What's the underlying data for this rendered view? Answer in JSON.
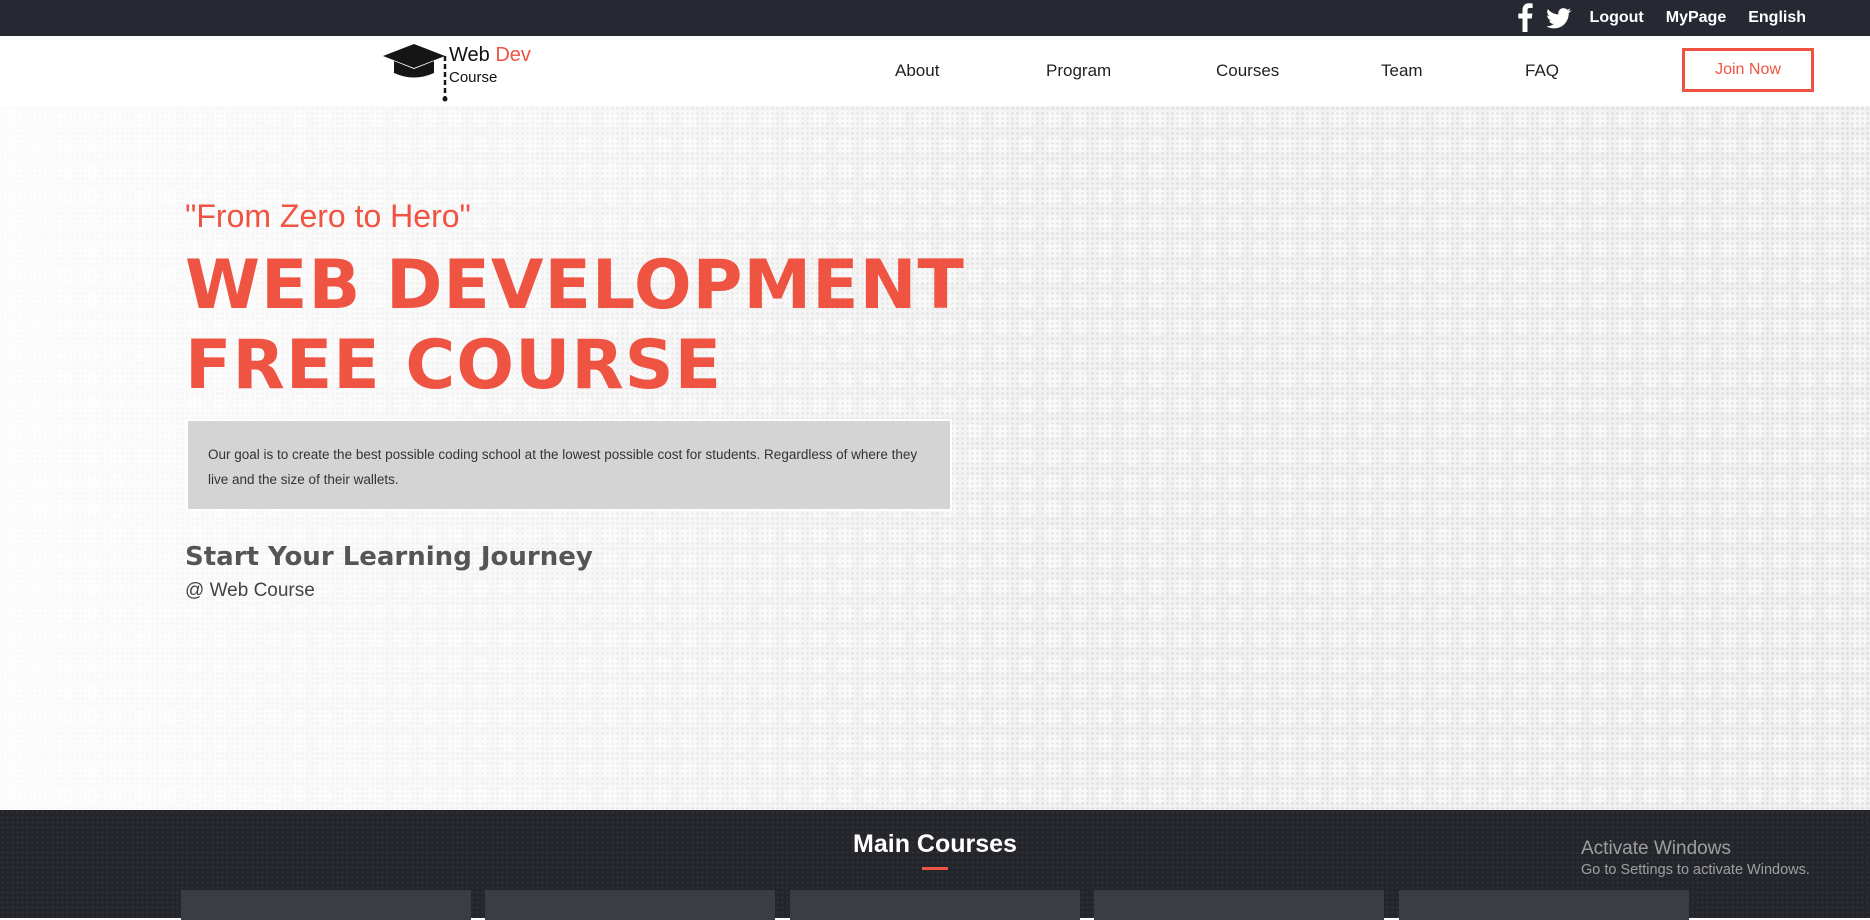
{
  "topbar": {
    "social_icons": [
      "facebook-icon",
      "twitter-icon"
    ],
    "links": [
      "Logout",
      "MyPage",
      "English"
    ]
  },
  "nav": {
    "logo": {
      "word1": "Web",
      "word2": "Dev",
      "word3": "Course"
    },
    "items": [
      "About",
      "Program",
      "Courses",
      "Team",
      "FAQ"
    ],
    "cta": "Join Now"
  },
  "hero": {
    "quote": "\"From Zero to Hero\"",
    "headline_line1": "WEB DEVELOPMENT",
    "headline_line2": "FREE COURSE",
    "description": "Our goal is to create the best possible coding school at the lowest possible cost for students. Regardless of where they live and the size of their wallets.",
    "journey": "Start Your Learning Journey",
    "sub": "@ Web Course"
  },
  "courses": {
    "title": "Main Courses"
  },
  "watermark": {
    "line1": "Activate Windows",
    "line2": "Go to Settings to activate Windows."
  },
  "colors": {
    "accent": "#ef5442",
    "topbar": "#262932",
    "dark_section": "#23252b"
  }
}
